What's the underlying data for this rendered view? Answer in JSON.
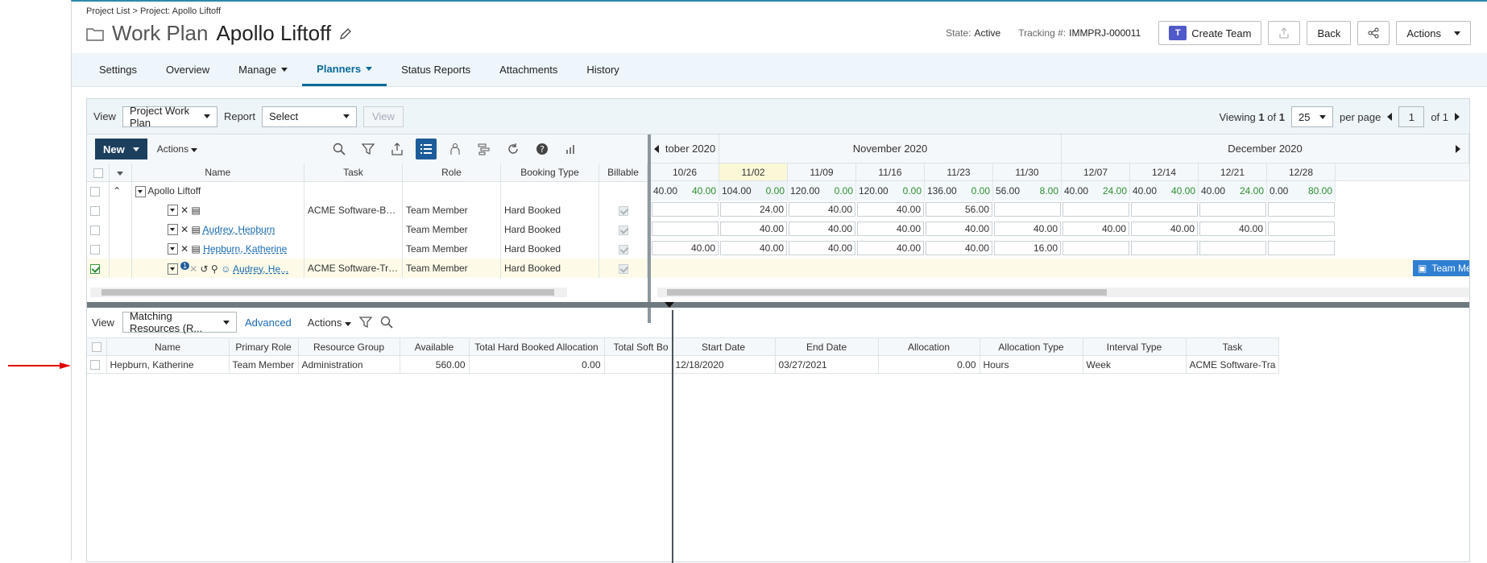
{
  "breadcrumb": "Project List > Project: Apollo Liftoff",
  "title": {
    "type": "Work Plan",
    "name": "Apollo Liftoff"
  },
  "header": {
    "state_label": "State:",
    "state_value": "Active",
    "tracking_label": "Tracking #:",
    "tracking_value": "IMMPRJ-000011",
    "create_team": "Create Team",
    "back": "Back",
    "actions": "Actions"
  },
  "tabs": [
    "Settings",
    "Overview",
    "Manage",
    "Planners",
    "Status Reports",
    "Attachments",
    "History"
  ],
  "viewbar": {
    "view_label": "View",
    "view_value": "Project Work Plan",
    "report_label": "Report",
    "report_value": "Select",
    "view_button": "View",
    "viewing_label": "Viewing",
    "viewing_from": "1",
    "of_label": "of",
    "viewing_total": "1",
    "per_page_value": "25",
    "per_page_label": "per page",
    "page_value": "1",
    "page_of": "of 1"
  },
  "gridtool": {
    "new": "New",
    "actions": "Actions"
  },
  "grid": {
    "columns": [
      "Name",
      "Task",
      "Role",
      "Booking Type",
      "Billable"
    ],
    "rows": [
      {
        "name": "Apollo Liftoff",
        "task": "",
        "role": "",
        "booking": ""
      },
      {
        "name": "",
        "task": "ACME Software-Boo...",
        "role": "Team Member",
        "booking": "Hard Booked"
      },
      {
        "name": "Audrey, Hepburn",
        "task": "",
        "role": "Team Member",
        "booking": "Hard Booked"
      },
      {
        "name": "Hepburn, Katherine",
        "task": "",
        "role": "Team Member",
        "booking": "Hard Booked"
      },
      {
        "name": "Audrey, He...",
        "task": "ACME Software-Trai...",
        "role": "Team Member",
        "booking": "Hard Booked",
        "badge": "1"
      }
    ]
  },
  "timeline": {
    "months": [
      "tober 2020",
      "November 2020",
      "December 2020"
    ],
    "weeks": [
      "10/26",
      "11/02",
      "11/09",
      "11/16",
      "11/23",
      "11/30",
      "12/07",
      "12/14",
      "12/21",
      "12/28"
    ],
    "summary": [
      [
        "40.00",
        "40.00"
      ],
      [
        "104.00",
        "0.00"
      ],
      [
        "120.00",
        "0.00"
      ],
      [
        "120.00",
        "0.00"
      ],
      [
        "136.00",
        "0.00"
      ],
      [
        "56.00",
        "8.00"
      ],
      [
        "40.00",
        "24.00"
      ],
      [
        "40.00",
        "40.00"
      ],
      [
        "40.00",
        "24.00"
      ],
      [
        "0.00",
        "80.00"
      ]
    ],
    "row1": [
      "",
      "24.00",
      "40.00",
      "40.00",
      "56.00",
      "",
      "",
      "",
      "",
      ""
    ],
    "row2": [
      "",
      "40.00",
      "40.00",
      "40.00",
      "40.00",
      "40.00",
      "40.00",
      "40.00",
      "40.00",
      ""
    ],
    "row3": [
      "40.00",
      "40.00",
      "40.00",
      "40.00",
      "40.00",
      "16.00",
      "",
      "",
      "",
      ""
    ],
    "bar_label": "Team Member (Audrey, Hepburn), Apol"
  },
  "bottom": {
    "view_label": "View",
    "view_value": "Matching Resources (R...",
    "advanced": "Advanced",
    "actions": "Actions",
    "columns": [
      "Name",
      "Primary Role",
      "Resource Group",
      "Available",
      "Total Hard Booked Allocation",
      "Total Soft Bo",
      "Start Date",
      "End Date",
      "Allocation",
      "Allocation Type",
      "Interval Type",
      "Task"
    ],
    "row": [
      "Hepburn, Katherine",
      "Team Member",
      "Administration",
      "560.00",
      "0.00",
      "",
      "12/18/2020",
      "03/27/2021",
      "0.00",
      "Hours",
      "Week",
      "ACME Software-Tra"
    ]
  }
}
